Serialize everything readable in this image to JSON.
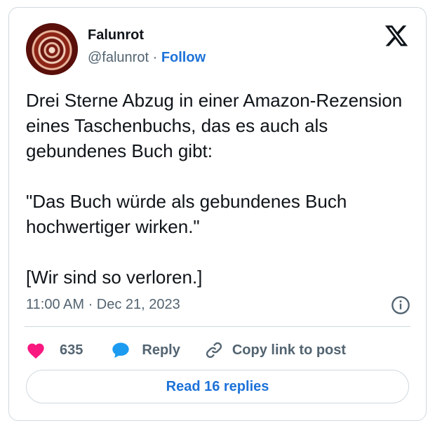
{
  "author": {
    "name": "Falunrot",
    "handle": "@falunrot",
    "separator": "·",
    "follow_label": "Follow"
  },
  "tweet": {
    "paragraphs": [
      "Drei Sterne Abzug in einer Amazon-Rezension eines Taschenbuchs, das es auch als gebundenes Buch gibt:",
      "\"Das Buch würde als gebundenes Buch hochwertiger wirken.\"",
      "[Wir sind so verloren.]"
    ],
    "timestamp": "11:00 AM · Dec 21, 2023"
  },
  "actions": {
    "like_count": "635",
    "reply_label": "Reply",
    "copy_link_label": "Copy link to post",
    "read_replies_label": "Read 16 replies"
  },
  "icons": {
    "logo": "x-logo-icon",
    "info": "info-icon",
    "like": "heart-icon",
    "reply": "speech-bubble-icon",
    "copy": "link-icon"
  },
  "colors": {
    "heart": "#f91880",
    "reply_bubble": "#1d9bf0",
    "link_blue": "#1d72d8",
    "border": "#cfd9de",
    "muted_text": "#536471"
  }
}
